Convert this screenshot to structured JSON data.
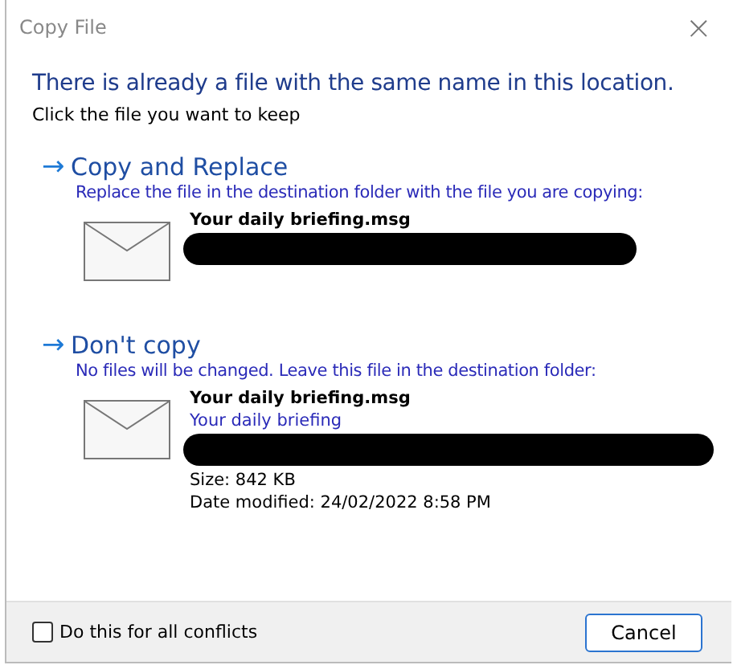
{
  "window": {
    "title": "Copy File",
    "close": "×"
  },
  "heading": "There is already a file with the same name in this location.",
  "instruction": "Click the file you want to keep",
  "options": [
    {
      "arrow": "→",
      "title": "Copy and Replace",
      "description": "Replace the file in the destination folder with the file you are copying:",
      "file": {
        "name": "Your daily briefing.msg",
        "redacted": true
      }
    },
    {
      "arrow": "→",
      "title": "Don't copy",
      "description": "No files will be changed. Leave this file in the destination folder:",
      "file": {
        "name": "Your daily briefing.msg",
        "subtitle": "Your daily briefing",
        "redacted": true,
        "size": "Size: 842 KB",
        "modified": "Date modified: 24/02/2022 8:58 PM"
      }
    }
  ],
  "footer": {
    "checkbox": {
      "label": "Do this for all conflicts",
      "checked": false
    },
    "buttons": [
      "Cancel"
    ]
  }
}
